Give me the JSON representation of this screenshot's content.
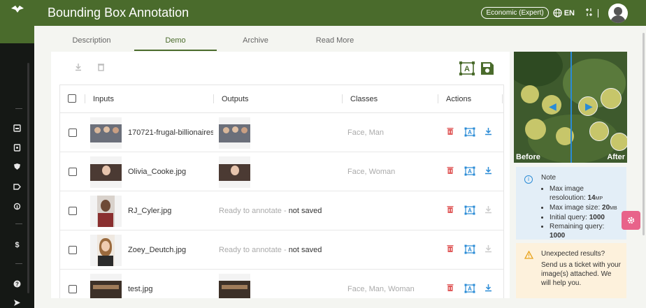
{
  "app": {
    "title": "Bounding Box Annotation",
    "plan": "Economic (Expert)",
    "language": "EN"
  },
  "tabs": [
    {
      "label": "Description"
    },
    {
      "label": "Demo"
    },
    {
      "label": "Archive"
    },
    {
      "label": "Read More"
    }
  ],
  "table": {
    "headers": {
      "inputs": "Inputs",
      "outputs": "Outputs",
      "classes": "Classes",
      "actions": "Actions"
    },
    "rows": [
      {
        "file": "170721-frugal-billionaires-",
        "status": "",
        "status_note": "",
        "classes": "Face, Man",
        "downloadable": true
      },
      {
        "file": "Olivia_Cooke.jpg",
        "status": "",
        "status_note": "",
        "classes": "Face, Woman",
        "downloadable": true
      },
      {
        "file": "RJ_Cyler.jpg",
        "status": "Ready to annotate - ",
        "status_note": "not saved",
        "classes": "",
        "downloadable": false
      },
      {
        "file": "Zoey_Deutch.jpg",
        "status": "Ready to annotate - ",
        "status_note": "not saved",
        "classes": "",
        "downloadable": false
      },
      {
        "file": "test.jpg",
        "status": "",
        "status_note": "",
        "classes": "Face, Man, Woman",
        "downloadable": true
      }
    ]
  },
  "compare": {
    "before": "Before",
    "after": "After"
  },
  "note": {
    "title": "Note",
    "items": [
      {
        "label": "Max image resoloution: ",
        "value": "14",
        "unit": "MP"
      },
      {
        "label": "Max image size: ",
        "value": "20",
        "unit": "MB"
      },
      {
        "label": "Initial query: ",
        "value": "1000",
        "unit": ""
      },
      {
        "label": "Remaining query: ",
        "value": "1000",
        "unit": ""
      }
    ]
  },
  "warning": {
    "title": "Unexpected results?",
    "body": "Send us a ticket with your image(s) attached. We will help you."
  },
  "colors": {
    "brand": "#4a6b2c",
    "accent": "#2a8bd6",
    "danger": "#e05a5a",
    "fab": "#e8638a"
  }
}
